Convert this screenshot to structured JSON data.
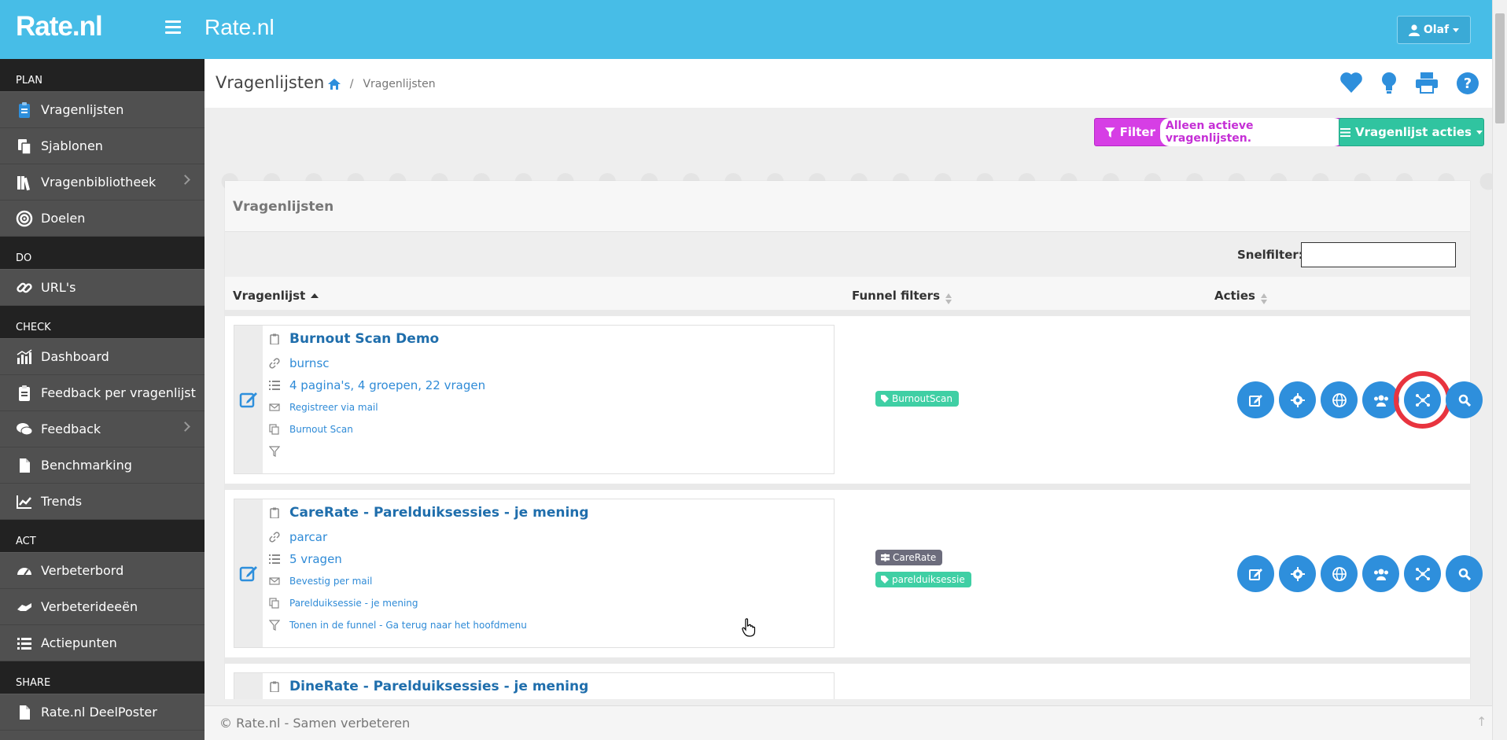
{
  "header": {
    "logo": "Rate.nl",
    "title": "Rate.nl",
    "user": "Olaf"
  },
  "sidebar": {
    "sections": [
      {
        "title": "PLAN",
        "items": [
          {
            "label": "Vragenlijsten",
            "icon": "clipboard-icon"
          },
          {
            "label": "Sjablonen",
            "icon": "copy-icon"
          },
          {
            "label": "Vragenbibliotheek",
            "icon": "books-icon",
            "chevron": true
          },
          {
            "label": "Doelen",
            "icon": "target-icon"
          }
        ]
      },
      {
        "title": "DO",
        "items": [
          {
            "label": "URL's",
            "icon": "link-icon"
          }
        ]
      },
      {
        "title": "CHECK",
        "items": [
          {
            "label": "Dashboard",
            "icon": "chart-icon"
          },
          {
            "label": "Feedback per vragenlijst",
            "icon": "clipboard-icon"
          },
          {
            "label": "Feedback",
            "icon": "comments-icon",
            "chevron": true
          },
          {
            "label": "Benchmarking",
            "icon": "file-icon"
          },
          {
            "label": "Trends",
            "icon": "line-chart-icon"
          }
        ]
      },
      {
        "title": "ACT",
        "items": [
          {
            "label": "Verbeterbord",
            "icon": "gauge-icon"
          },
          {
            "label": "Verbeterideeën",
            "icon": "hands-icon"
          },
          {
            "label": "Actiepunten",
            "icon": "list-icon"
          }
        ]
      },
      {
        "title": "SHARE",
        "items": [
          {
            "label": "Rate.nl DeelPoster",
            "icon": "pdf-icon"
          }
        ]
      }
    ]
  },
  "breadcrumb": {
    "title": "Vragenlijsten",
    "current": "Vragenlijsten"
  },
  "toolbar": {
    "filter_label": "Filter",
    "filter_value": "Alleen actieve vragenlijsten.",
    "actions_label": "Vragenlijst acties"
  },
  "panel": {
    "title": "Vragenlijsten",
    "quickfilter_label": "Snelfilter:"
  },
  "table": {
    "columns": [
      "Vragenlijst",
      "Funnel filters",
      "Acties"
    ]
  },
  "rows": [
    {
      "title": "Burnout Scan Demo",
      "code": "burnsc",
      "summary": "4 pagina's, 4 groepen, 22 vragen",
      "mail": "Registreer via mail",
      "template": "Burnout Scan",
      "funnel": "",
      "tags": [
        {
          "label": "BurnoutScan",
          "color": "green"
        }
      ]
    },
    {
      "title": "CareRate - Parelduiksessies - je mening",
      "code": "parcar",
      "summary": "5 vragen",
      "mail": "Bevestig per mail",
      "template": "Parelduiksessie - je mening",
      "funnel": "Tonen in de funnel - Ga terug naar het hoofdmenu",
      "tags": [
        {
          "label": "CareRate",
          "color": "gray"
        },
        {
          "label": "parelduiksessie",
          "color": "green"
        }
      ]
    },
    {
      "title": "DineRate - Parelduiksessies - je mening"
    }
  ],
  "footer": "© Rate.nl - Samen verbeteren",
  "colors": {
    "topbar": "#47bde7",
    "sidebar": "#505050",
    "accent": "#2e8fdc",
    "filter": "#d63ee5",
    "actions": "#30c4a0",
    "highlight": "#e8343f"
  }
}
